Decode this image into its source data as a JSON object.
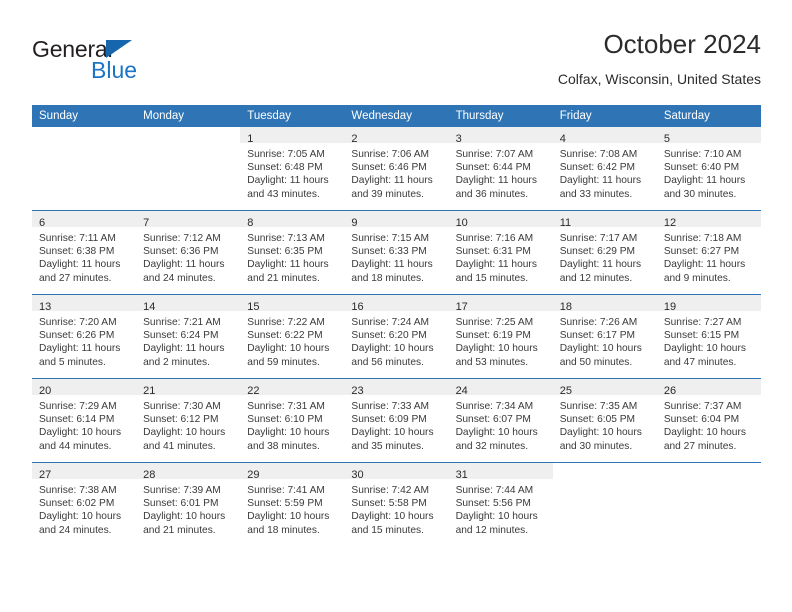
{
  "brand": {
    "name_top": "General",
    "name_bottom": "Blue",
    "triangle_color": "#1566ad",
    "blue_color": "#1b74c4"
  },
  "header": {
    "title": "October 2024",
    "location": "Colfax, Wisconsin, United States"
  },
  "theme": {
    "header_bg": "#2f75b5",
    "header_text": "#ffffff",
    "daynum_band_bg": "#efefef",
    "row_divider": "#2f75b5",
    "body_text": "#3a3a3a"
  },
  "weekday_headers": [
    "Sunday",
    "Monday",
    "Tuesday",
    "Wednesday",
    "Thursday",
    "Friday",
    "Saturday"
  ],
  "weeks": [
    [
      {
        "day": "",
        "lines": []
      },
      {
        "day": "",
        "lines": []
      },
      {
        "day": "1",
        "lines": [
          "Sunrise: 7:05 AM",
          "Sunset: 6:48 PM",
          "Daylight: 11 hours",
          "and 43 minutes."
        ]
      },
      {
        "day": "2",
        "lines": [
          "Sunrise: 7:06 AM",
          "Sunset: 6:46 PM",
          "Daylight: 11 hours",
          "and 39 minutes."
        ]
      },
      {
        "day": "3",
        "lines": [
          "Sunrise: 7:07 AM",
          "Sunset: 6:44 PM",
          "Daylight: 11 hours",
          "and 36 minutes."
        ]
      },
      {
        "day": "4",
        "lines": [
          "Sunrise: 7:08 AM",
          "Sunset: 6:42 PM",
          "Daylight: 11 hours",
          "and 33 minutes."
        ]
      },
      {
        "day": "5",
        "lines": [
          "Sunrise: 7:10 AM",
          "Sunset: 6:40 PM",
          "Daylight: 11 hours",
          "and 30 minutes."
        ]
      }
    ],
    [
      {
        "day": "6",
        "lines": [
          "Sunrise: 7:11 AM",
          "Sunset: 6:38 PM",
          "Daylight: 11 hours",
          "and 27 minutes."
        ]
      },
      {
        "day": "7",
        "lines": [
          "Sunrise: 7:12 AM",
          "Sunset: 6:36 PM",
          "Daylight: 11 hours",
          "and 24 minutes."
        ]
      },
      {
        "day": "8",
        "lines": [
          "Sunrise: 7:13 AM",
          "Sunset: 6:35 PM",
          "Daylight: 11 hours",
          "and 21 minutes."
        ]
      },
      {
        "day": "9",
        "lines": [
          "Sunrise: 7:15 AM",
          "Sunset: 6:33 PM",
          "Daylight: 11 hours",
          "and 18 minutes."
        ]
      },
      {
        "day": "10",
        "lines": [
          "Sunrise: 7:16 AM",
          "Sunset: 6:31 PM",
          "Daylight: 11 hours",
          "and 15 minutes."
        ]
      },
      {
        "day": "11",
        "lines": [
          "Sunrise: 7:17 AM",
          "Sunset: 6:29 PM",
          "Daylight: 11 hours",
          "and 12 minutes."
        ]
      },
      {
        "day": "12",
        "lines": [
          "Sunrise: 7:18 AM",
          "Sunset: 6:27 PM",
          "Daylight: 11 hours",
          "and 9 minutes."
        ]
      }
    ],
    [
      {
        "day": "13",
        "lines": [
          "Sunrise: 7:20 AM",
          "Sunset: 6:26 PM",
          "Daylight: 11 hours",
          "and 5 minutes."
        ]
      },
      {
        "day": "14",
        "lines": [
          "Sunrise: 7:21 AM",
          "Sunset: 6:24 PM",
          "Daylight: 11 hours",
          "and 2 minutes."
        ]
      },
      {
        "day": "15",
        "lines": [
          "Sunrise: 7:22 AM",
          "Sunset: 6:22 PM",
          "Daylight: 10 hours",
          "and 59 minutes."
        ]
      },
      {
        "day": "16",
        "lines": [
          "Sunrise: 7:24 AM",
          "Sunset: 6:20 PM",
          "Daylight: 10 hours",
          "and 56 minutes."
        ]
      },
      {
        "day": "17",
        "lines": [
          "Sunrise: 7:25 AM",
          "Sunset: 6:19 PM",
          "Daylight: 10 hours",
          "and 53 minutes."
        ]
      },
      {
        "day": "18",
        "lines": [
          "Sunrise: 7:26 AM",
          "Sunset: 6:17 PM",
          "Daylight: 10 hours",
          "and 50 minutes."
        ]
      },
      {
        "day": "19",
        "lines": [
          "Sunrise: 7:27 AM",
          "Sunset: 6:15 PM",
          "Daylight: 10 hours",
          "and 47 minutes."
        ]
      }
    ],
    [
      {
        "day": "20",
        "lines": [
          "Sunrise: 7:29 AM",
          "Sunset: 6:14 PM",
          "Daylight: 10 hours",
          "and 44 minutes."
        ]
      },
      {
        "day": "21",
        "lines": [
          "Sunrise: 7:30 AM",
          "Sunset: 6:12 PM",
          "Daylight: 10 hours",
          "and 41 minutes."
        ]
      },
      {
        "day": "22",
        "lines": [
          "Sunrise: 7:31 AM",
          "Sunset: 6:10 PM",
          "Daylight: 10 hours",
          "and 38 minutes."
        ]
      },
      {
        "day": "23",
        "lines": [
          "Sunrise: 7:33 AM",
          "Sunset: 6:09 PM",
          "Daylight: 10 hours",
          "and 35 minutes."
        ]
      },
      {
        "day": "24",
        "lines": [
          "Sunrise: 7:34 AM",
          "Sunset: 6:07 PM",
          "Daylight: 10 hours",
          "and 32 minutes."
        ]
      },
      {
        "day": "25",
        "lines": [
          "Sunrise: 7:35 AM",
          "Sunset: 6:05 PM",
          "Daylight: 10 hours",
          "and 30 minutes."
        ]
      },
      {
        "day": "26",
        "lines": [
          "Sunrise: 7:37 AM",
          "Sunset: 6:04 PM",
          "Daylight: 10 hours",
          "and 27 minutes."
        ]
      }
    ],
    [
      {
        "day": "27",
        "lines": [
          "Sunrise: 7:38 AM",
          "Sunset: 6:02 PM",
          "Daylight: 10 hours",
          "and 24 minutes."
        ]
      },
      {
        "day": "28",
        "lines": [
          "Sunrise: 7:39 AM",
          "Sunset: 6:01 PM",
          "Daylight: 10 hours",
          "and 21 minutes."
        ]
      },
      {
        "day": "29",
        "lines": [
          "Sunrise: 7:41 AM",
          "Sunset: 5:59 PM",
          "Daylight: 10 hours",
          "and 18 minutes."
        ]
      },
      {
        "day": "30",
        "lines": [
          "Sunrise: 7:42 AM",
          "Sunset: 5:58 PM",
          "Daylight: 10 hours",
          "and 15 minutes."
        ]
      },
      {
        "day": "31",
        "lines": [
          "Sunrise: 7:44 AM",
          "Sunset: 5:56 PM",
          "Daylight: 10 hours",
          "and 12 minutes."
        ]
      },
      {
        "day": "",
        "lines": []
      },
      {
        "day": "",
        "lines": []
      }
    ]
  ]
}
